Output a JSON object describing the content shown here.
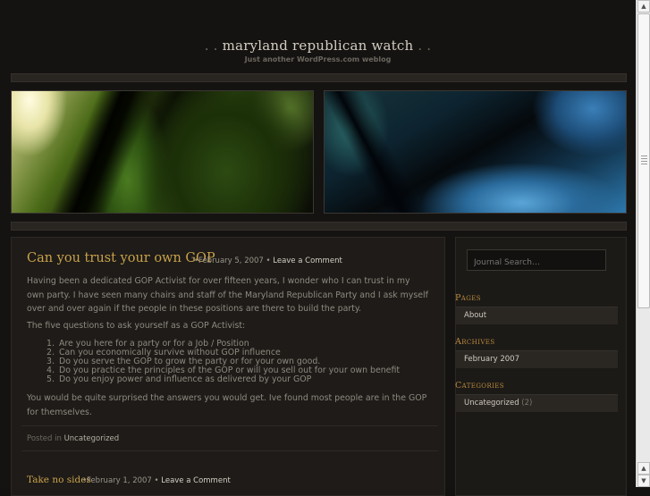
{
  "header": {
    "dots_left": ". .",
    "title": "maryland republican watch",
    "dots_right": ". .",
    "tagline": "Just another WordPress.com weblog"
  },
  "post1": {
    "title": "Can you trust your own GOP",
    "date": "•February 5, 2007",
    "separator": "•",
    "comment_link": "Leave a Comment",
    "para1": "Having been a dedicated GOP Activist for over fifteen years, I wonder who I can trust in my own party. I have seen many chairs and staff of the Maryland Republican Party and I ask myself over and over again if the people in these positions are there to build the party.",
    "para2": "The five questions to ask yourself as a GOP Activist:",
    "questions": [
      {
        "num": "1.",
        "text": "Are you here for a party or for a Job / Position"
      },
      {
        "num": "2.",
        "text": "Can you economically survive without GOP influence"
      },
      {
        "num": "3.",
        "text": "Do you serve the GOP to grow the party or for your own good."
      },
      {
        "num": "4.",
        "text": "Do you practice the principles of the GOP or will you sell out for your own benefit"
      },
      {
        "num": "5.",
        "text": "Do you enjoy power and influence as delivered by your GOP"
      }
    ],
    "para3": "You would be quite surprised the answers you would get. Ive found most people are in the GOP for themselves.",
    "posted_in_label": "Posted in",
    "category": "Uncategorized"
  },
  "post2": {
    "title": "Take no sides",
    "date": "•February 1, 2007",
    "separator": "•",
    "comment_link": "Leave a Comment"
  },
  "sidebar": {
    "search_placeholder": "Journal Search…",
    "pages_heading": "Pages",
    "pages": [
      "About"
    ],
    "archives_heading": "Archives",
    "archives": [
      "February 2007"
    ],
    "categories_heading": "Categories",
    "categories": [
      {
        "name": "Uncategorized",
        "count": "(2)"
      }
    ]
  },
  "scrollbar": {
    "up_arrow": "▲",
    "down_arrow": "▼"
  }
}
